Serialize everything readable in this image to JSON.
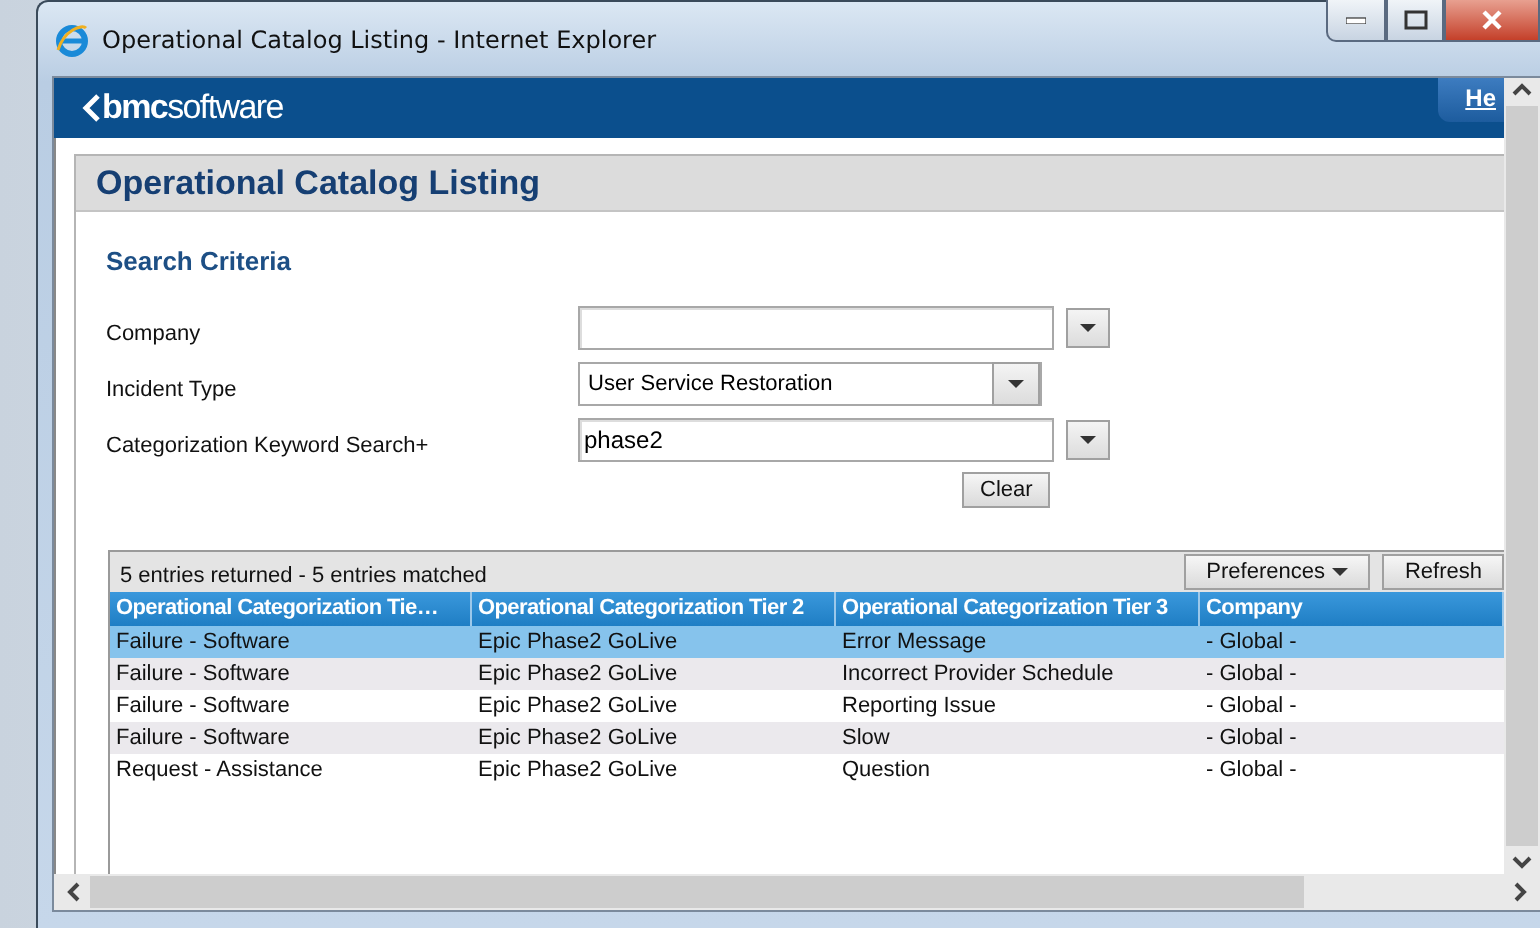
{
  "window": {
    "title": "Operational Catalog Listing - Internet Explorer"
  },
  "header": {
    "logo": "**bmc**software",
    "help_link": "He"
  },
  "panel": {
    "title": "Operational Catalog Listing"
  },
  "search": {
    "title": "Search Criteria",
    "fields": [
      {
        "label": "Company",
        "kind": "combo"
      },
      {
        "label": "Incident Type",
        "kind": "select",
        "value": "User Service Restoration"
      },
      {
        "label": "Categorization Keyword Search+",
        "kind": "combo",
        "value": "phase2"
      }
    ],
    "clear_button": "Clear"
  },
  "results": {
    "summary": "5 entries returned - 5 entries matched",
    "buttons": [
      {
        "label": "Preferences",
        "kind": "menu"
      },
      {
        "label": "Refresh",
        "kind": "plain"
      }
    ],
    "columns": [
      "Operational Categorization Tie…",
      "Operational Categorization Tier 2",
      "Operational Categorization Tier 3",
      "Company"
    ],
    "rows": [
      {
        "cells": [
          "Failure - Software",
          "Epic Phase2 GoLive",
          "Error Message",
          "- Global -"
        ],
        "selected": true
      },
      {
        "cells": [
          "Failure - Software",
          "Epic Phase2 GoLive",
          "Incorrect Provider Schedule",
          "- Global -"
        ],
        "selected": false
      },
      {
        "cells": [
          "Failure - Software",
          "Epic Phase2 GoLive",
          "Reporting Issue",
          "- Global -"
        ],
        "selected": false
      },
      {
        "cells": [
          "Failure - Software",
          "Epic Phase2 GoLive",
          "Slow",
          "- Global -"
        ],
        "selected": false
      },
      {
        "cells": [
          "Request - Assistance",
          "Epic Phase2 GoLive",
          "Question",
          "- Global -"
        ],
        "selected": false
      }
    ]
  }
}
